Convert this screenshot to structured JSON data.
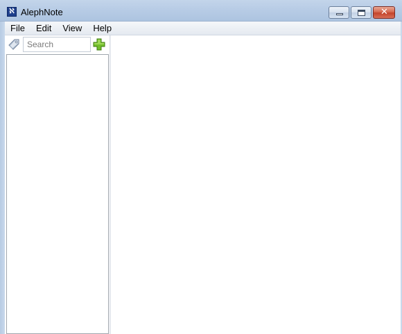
{
  "window": {
    "title": "AlephNote",
    "icon": "alephnote-app-icon"
  },
  "menu": {
    "items": [
      {
        "label": "File"
      },
      {
        "label": "Edit"
      },
      {
        "label": "View"
      },
      {
        "label": "Help"
      }
    ]
  },
  "sidebar": {
    "search_placeholder": "Search",
    "search_value": "",
    "tag_icon": "tag-icon",
    "add_icon": "plus-icon",
    "notes": []
  },
  "colors": {
    "titlebar": "#b9cde6",
    "add_button": "#6fb82a",
    "close_button": "#c3442b"
  }
}
